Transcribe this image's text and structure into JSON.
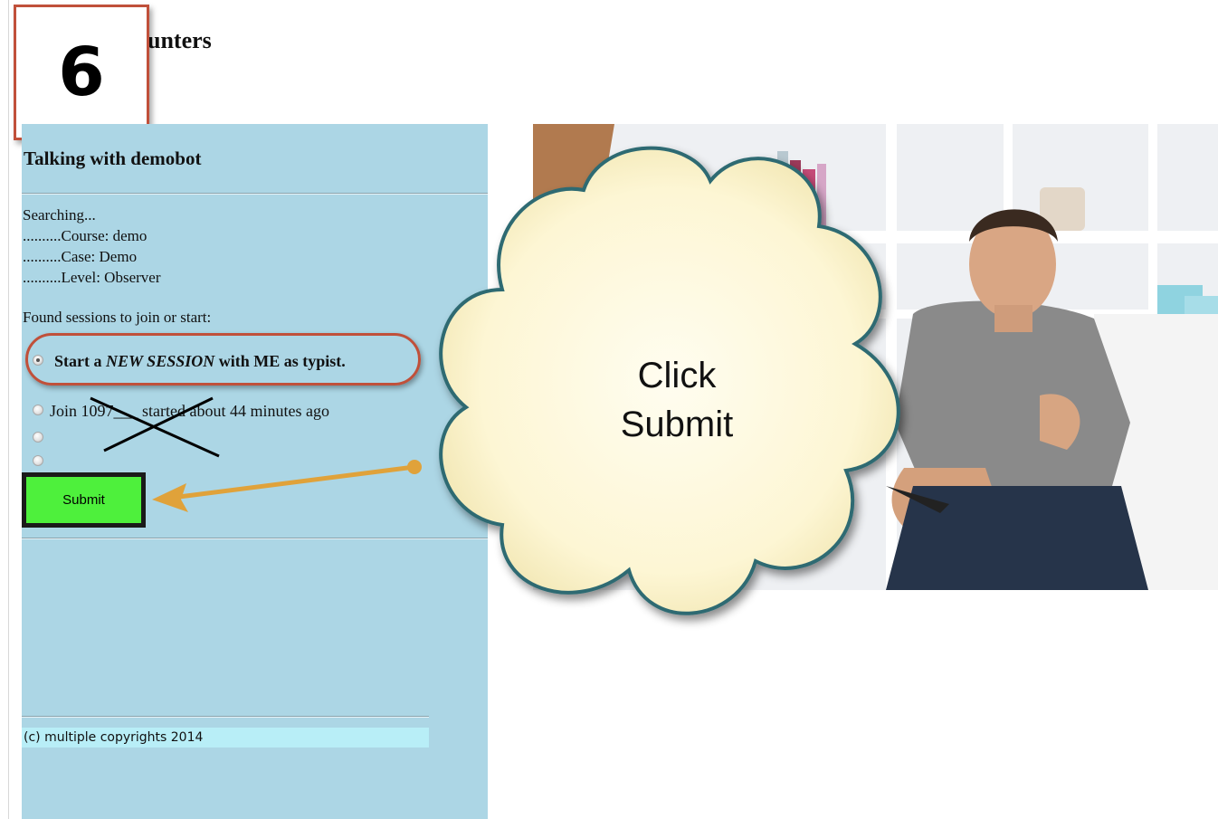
{
  "page": {
    "heading_fragment": "ounters",
    "step_badge": "6"
  },
  "panel": {
    "title": "Talking with demobot",
    "status_lines": [
      "Searching...",
      "..........Course: demo",
      "..........Case: Demo",
      "..........Level: Observer"
    ],
    "found_label": "Found sessions to join or start:",
    "options": {
      "new_session": {
        "prefix": "Start a ",
        "emphasis": "NEW SESSION",
        "suffix": " with ME as typist.",
        "checked": true
      },
      "join_session": {
        "label": "Join 1097___ started about 44 minutes ago",
        "checked": false
      },
      "blank_option_1": {
        "label": "",
        "checked": false
      },
      "blank_option_2": {
        "label": "",
        "checked": false
      }
    },
    "submit_label": "Submit",
    "footer": "(c) multiple copyrights 2014"
  },
  "callout": {
    "line1": "Click",
    "line2": "Submit"
  },
  "colors": {
    "panel_bg": "#acd6e5",
    "footer_bg": "#b8eef7",
    "submit_bg": "#4ef03c",
    "highlight": "#c0503a",
    "arrow": "#e0a23a",
    "cloud_fill": "#fdf6d4",
    "cloud_stroke": "#2d6b72"
  },
  "icons": [
    "radio-button-icon",
    "cross-out-mark-icon",
    "pointer-arrow-icon",
    "thought-cloud-icon"
  ]
}
